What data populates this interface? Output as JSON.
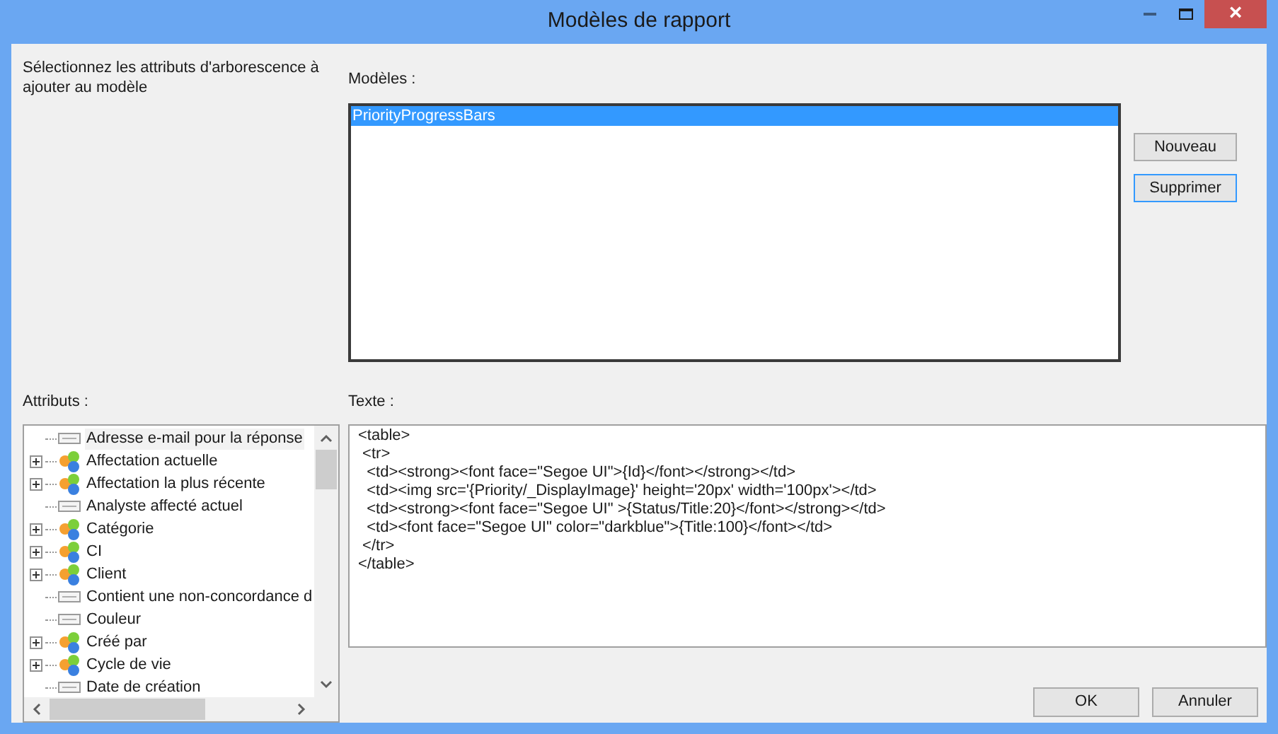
{
  "window": {
    "title": "Modèles de rapport",
    "close": "×"
  },
  "instruction": "Sélectionnez les attributs d'arborescence à ajouter au modèle",
  "models": {
    "label": "Modèles :",
    "items": [
      {
        "name": "PriorityProgressBars",
        "selected": true
      }
    ]
  },
  "model_buttons": [
    {
      "label": "Nouveau",
      "focused": false
    },
    {
      "label": "Supprimer",
      "focused": true
    }
  ],
  "attributes": {
    "label": "Attributs :",
    "items": [
      {
        "name": "Adresse e-mail pour la réponse",
        "kind": "field",
        "selected": true
      },
      {
        "name": "Affectation actuelle",
        "kind": "group",
        "selected": false
      },
      {
        "name": "Affectation la plus récente",
        "kind": "group",
        "selected": false
      },
      {
        "name": "Analyste affecté actuel",
        "kind": "field",
        "selected": false
      },
      {
        "name": "Catégorie",
        "kind": "group",
        "selected": false
      },
      {
        "name": "CI",
        "kind": "group",
        "selected": false
      },
      {
        "name": "Client",
        "kind": "group",
        "selected": false
      },
      {
        "name": "Contient une non-concordance d",
        "kind": "field",
        "selected": false
      },
      {
        "name": "Couleur",
        "kind": "field",
        "selected": false
      },
      {
        "name": "Créé par",
        "kind": "group",
        "selected": false
      },
      {
        "name": "Cycle de vie",
        "kind": "group",
        "selected": false
      },
      {
        "name": "Date de création",
        "kind": "field",
        "selected": false
      }
    ]
  },
  "text": {
    "label": "Texte :",
    "lines": [
      "<table>",
      " <tr>",
      "  <td><strong><font face=\"Segoe UI\">{Id}</font></strong></td>",
      "  <td><img src='{Priority/_DisplayImage}' height='20px' width='100px'></td>",
      "  <td><strong><font face=\"Segoe UI\" >{Status/Title:20}</font></strong></td>",
      "  <td><font face=\"Segoe UI\" color=\"darkblue\">{Title:100}</font></td>",
      " </tr>",
      "</table>"
    ]
  },
  "buttons": [
    "OK",
    "Annuler"
  ]
}
